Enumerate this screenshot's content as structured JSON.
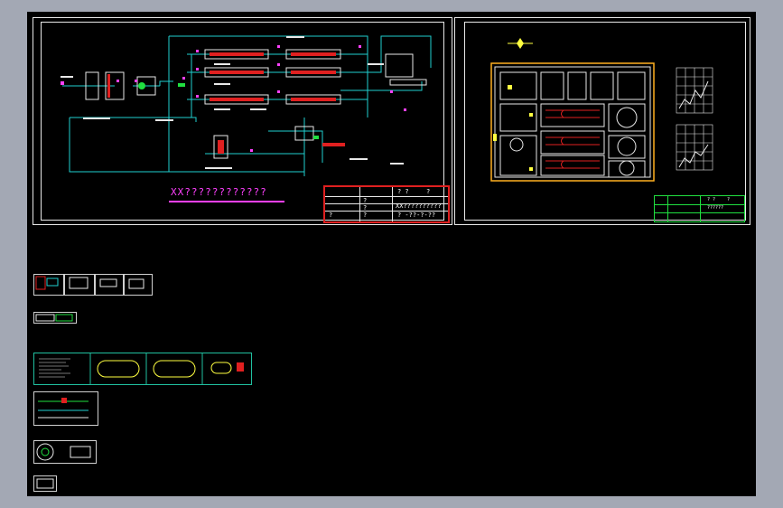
{
  "drawing": {
    "process_sheet": {
      "title": "XX????????????",
      "title_block": {
        "project_title": "XX??????????",
        "row_labels": [
          "?",
          "?",
          "?",
          "?"
        ],
        "header_cells": [
          "? ?",
          "?"
        ],
        "bottom_cell": "? -??-?-??"
      }
    },
    "layout_sheet": {
      "title_block": {
        "cells": [
          "? ?",
          "?",
          "??????"
        ]
      }
    }
  },
  "colors": {
    "background": "#000000",
    "frame": "#e8e8e8",
    "pipe_cyan": "#20d0d0",
    "magenta": "#ff40ff",
    "red": "#e02020",
    "green": "#20e040",
    "yellow": "#ffff40",
    "outer_gray": "#a3a8b4"
  }
}
